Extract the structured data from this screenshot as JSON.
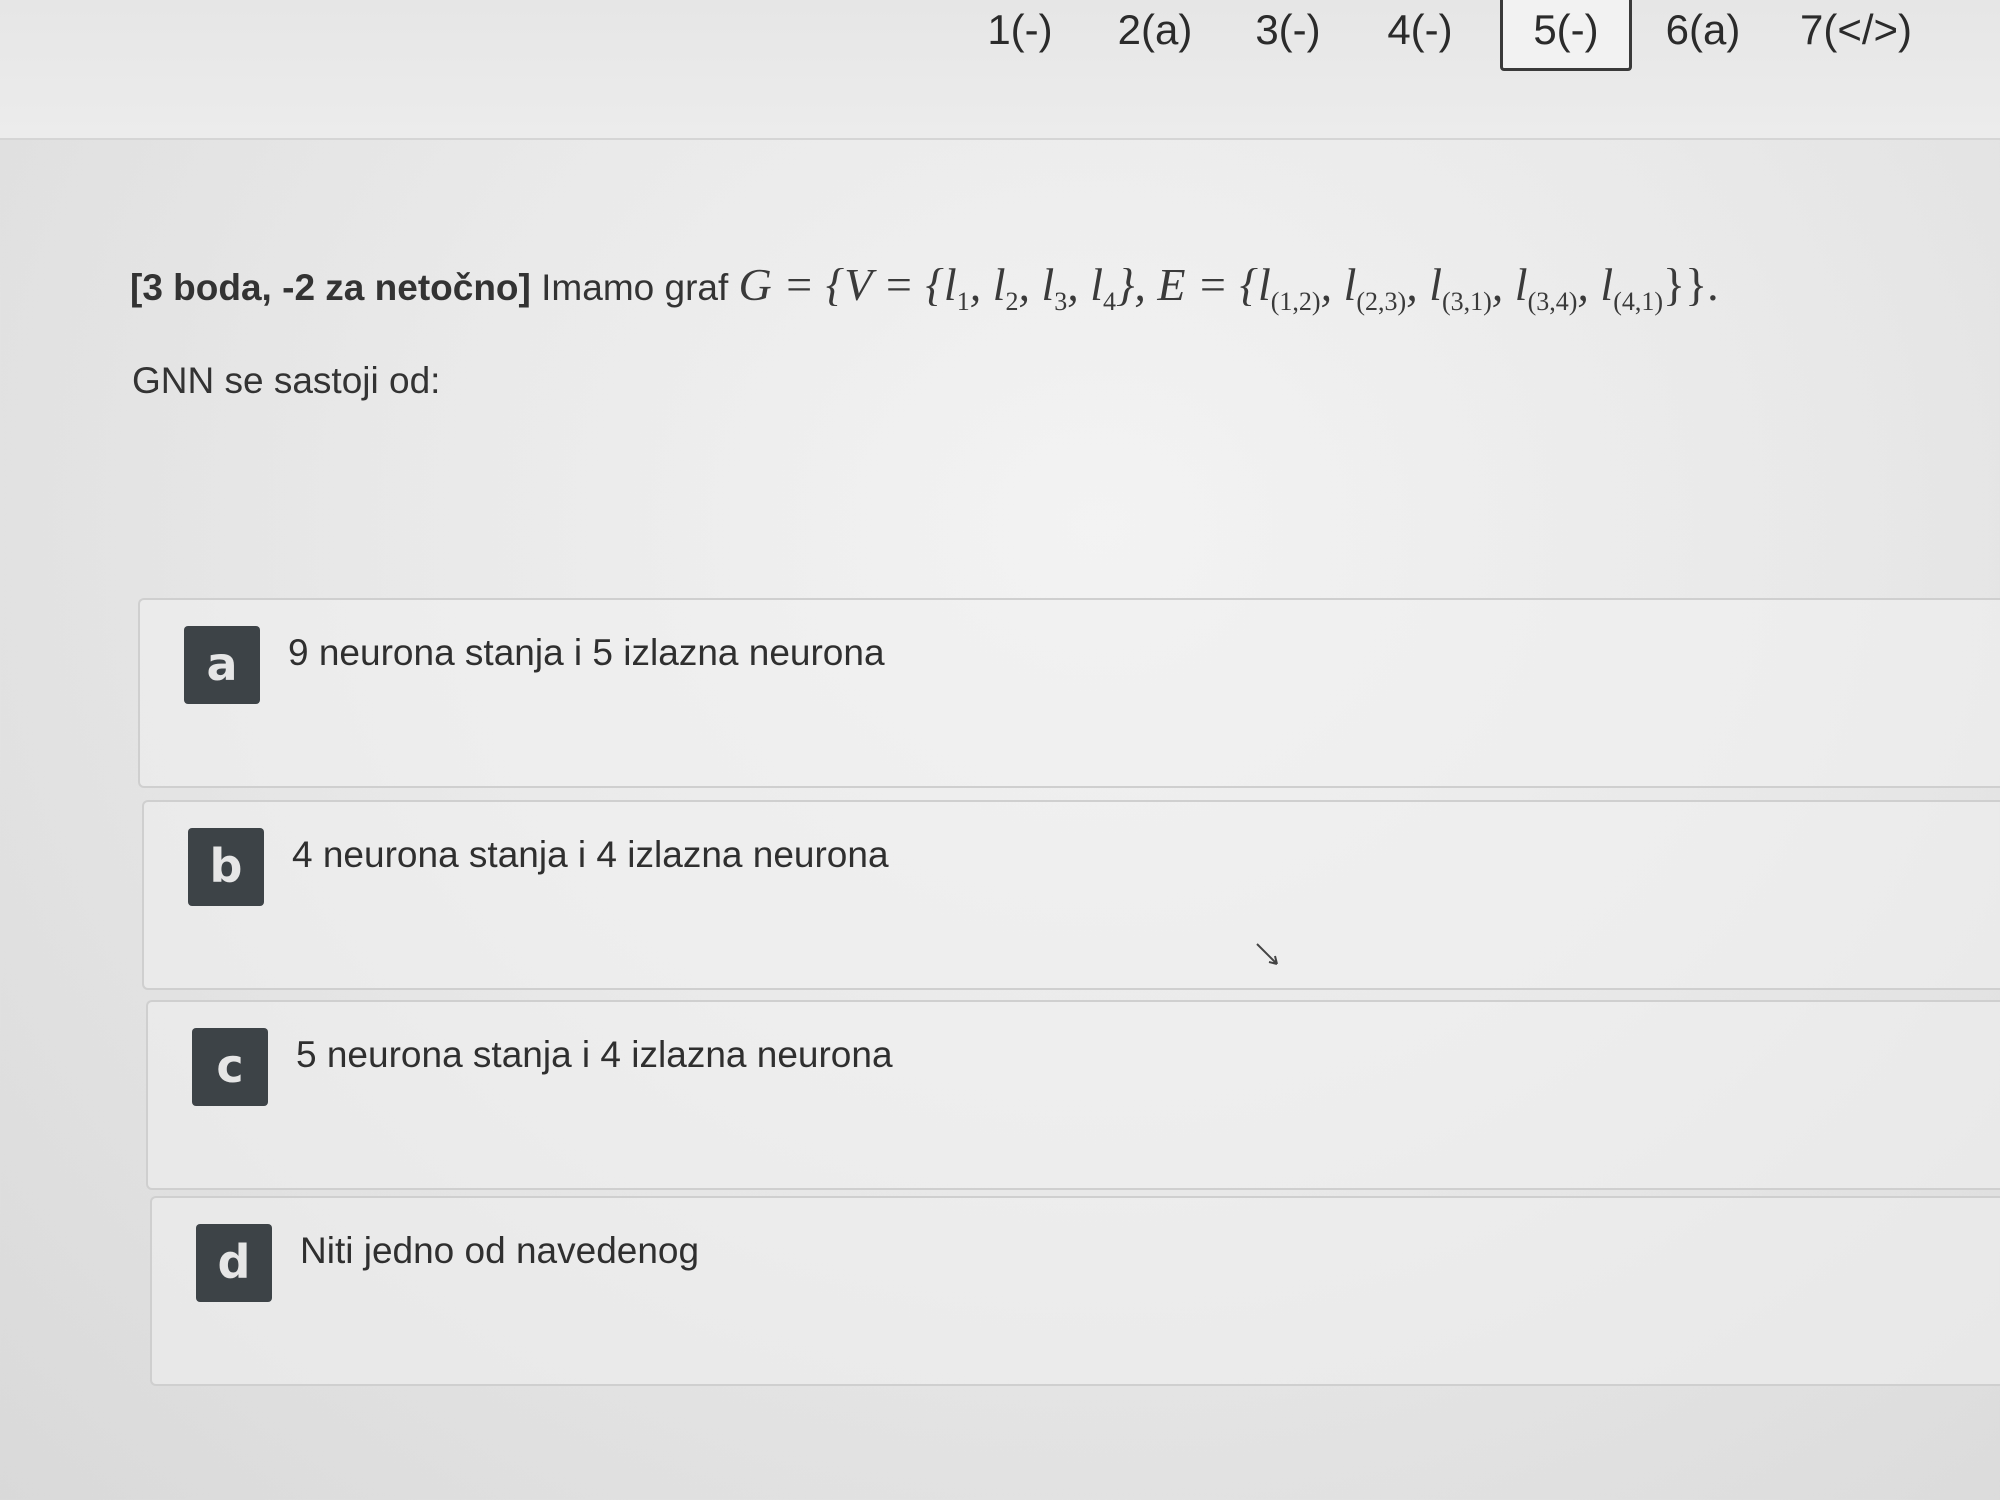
{
  "nav": {
    "items": [
      {
        "label": "1(-)"
      },
      {
        "label": "2(a)"
      },
      {
        "label": "3(-)"
      },
      {
        "label": "4(-)"
      },
      {
        "label": "5(-)",
        "active": true
      },
      {
        "label": "6(a)"
      },
      {
        "label": "7(</>)"
      }
    ]
  },
  "question": {
    "points": "[3 boda, -2 za netočno]",
    "intro": "Imamo graf",
    "math_part1": "G = {V = {l",
    "subs_v": [
      "1",
      "2",
      "3",
      "4"
    ],
    "math_part2": "}, E = {",
    "subs_e": [
      "(1,2)",
      "(2,3)",
      "(3,1)",
      "(3,4)",
      "(4,1)"
    ],
    "math_end": "}}.",
    "sub_question": "GNN se sastoji od:"
  },
  "answers": [
    {
      "letter": "a",
      "text": "9 neurona stanja i 5 izlazna neurona"
    },
    {
      "letter": "b",
      "text": "4 neurona stanja i 4 izlazna neurona"
    },
    {
      "letter": "c",
      "text": "5 neurona stanja i 4 izlazna neurona"
    },
    {
      "letter": "d",
      "text": "Niti jedno od navedenog"
    }
  ],
  "colors": {
    "letter_bg": "#3d4347",
    "border": "#cfcfcf"
  }
}
